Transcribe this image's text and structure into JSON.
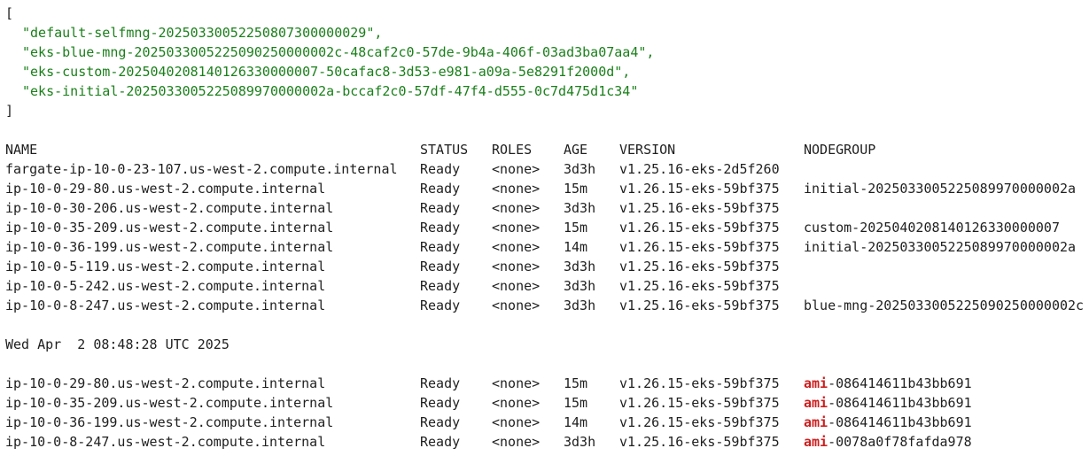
{
  "json_block": {
    "open": "[",
    "items": [
      "\"default-selfmng-20250330052250807300000029\",",
      "\"eks-blue-mng-2025033005225090250000002c-48caf2c0-57de-9b4a-406f-03ad3ba07aa4\",",
      "\"eks-custom-2025040208140126330000007-50cafac8-3d53-e981-a09a-5e8291f2000d\",",
      "\"eks-initial-2025033005225089970000002a-bccaf2c0-57df-47f4-d555-0c7d475d1c34\""
    ],
    "close": "]"
  },
  "nodes_table": {
    "headers": [
      "NAME",
      "STATUS",
      "ROLES",
      "AGE",
      "VERSION",
      "NODEGROUP"
    ],
    "rows": [
      [
        "fargate-ip-10-0-23-107.us-west-2.compute.internal",
        "Ready",
        "<none>",
        "3d3h",
        "v1.25.16-eks-2d5f260",
        ""
      ],
      [
        "ip-10-0-29-80.us-west-2.compute.internal",
        "Ready",
        "<none>",
        "15m",
        "v1.26.15-eks-59bf375",
        "initial-2025033005225089970000002a"
      ],
      [
        "ip-10-0-30-206.us-west-2.compute.internal",
        "Ready",
        "<none>",
        "3d3h",
        "v1.25.16-eks-59bf375",
        ""
      ],
      [
        "ip-10-0-35-209.us-west-2.compute.internal",
        "Ready",
        "<none>",
        "15m",
        "v1.26.15-eks-59bf375",
        "custom-2025040208140126330000007"
      ],
      [
        "ip-10-0-36-199.us-west-2.compute.internal",
        "Ready",
        "<none>",
        "14m",
        "v1.26.15-eks-59bf375",
        "initial-2025033005225089970000002a"
      ],
      [
        "ip-10-0-5-119.us-west-2.compute.internal",
        "Ready",
        "<none>",
        "3d3h",
        "v1.25.16-eks-59bf375",
        ""
      ],
      [
        "ip-10-0-5-242.us-west-2.compute.internal",
        "Ready",
        "<none>",
        "3d3h",
        "v1.25.16-eks-59bf375",
        ""
      ],
      [
        "ip-10-0-8-247.us-west-2.compute.internal",
        "Ready",
        "<none>",
        "3d3h",
        "v1.25.16-eks-59bf375",
        "blue-mng-2025033005225090250000002c"
      ]
    ]
  },
  "date_line": "Wed Apr  2 08:48:28 UTC 2025",
  "ami_table": {
    "rows": [
      [
        "ip-10-0-29-80.us-west-2.compute.internal",
        "Ready",
        "<none>",
        "15m",
        "v1.26.15-eks-59bf375",
        "ami",
        "-086414611b43bb691"
      ],
      [
        "ip-10-0-35-209.us-west-2.compute.internal",
        "Ready",
        "<none>",
        "15m",
        "v1.26.15-eks-59bf375",
        "ami",
        "-086414611b43bb691"
      ],
      [
        "ip-10-0-36-199.us-west-2.compute.internal",
        "Ready",
        "<none>",
        "14m",
        "v1.26.15-eks-59bf375",
        "ami",
        "-086414611b43bb691"
      ],
      [
        "ip-10-0-8-247.us-west-2.compute.internal",
        "Ready",
        "<none>",
        "3d3h",
        "v1.25.16-eks-59bf375",
        "ami",
        "-0078a0f78fafda978"
      ]
    ]
  },
  "colors": {
    "json_string": "#1a7f1a",
    "ami_highlight": "#cc1f1f",
    "text": "#1f1f1f",
    "background": "#ffffff"
  }
}
